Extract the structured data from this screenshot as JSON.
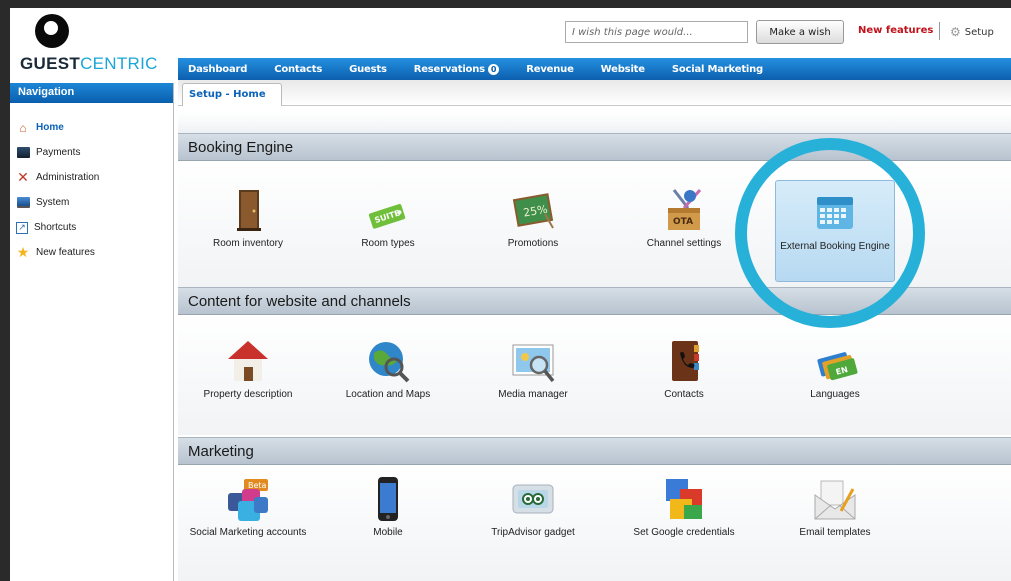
{
  "brand": {
    "part1": "GUEST",
    "part2": "CENTRIC"
  },
  "toolbar": {
    "wish_placeholder": "I wish this page would...",
    "wish_button": "Make a wish",
    "new_features": "New features",
    "setup": "Setup"
  },
  "nav": {
    "header": "Navigation",
    "items": [
      {
        "label": "Home",
        "icon": "home-icon"
      },
      {
        "label": "Payments",
        "icon": "payments-icon"
      },
      {
        "label": "Administration",
        "icon": "administration-icon"
      },
      {
        "label": "System",
        "icon": "system-icon"
      },
      {
        "label": "Shortcuts",
        "icon": "shortcuts-icon"
      },
      {
        "label": "New features",
        "icon": "star-icon"
      }
    ]
  },
  "topnav": {
    "items": [
      "Dashboard",
      "Contacts",
      "Guests",
      "Reservations",
      "Revenue",
      "Website",
      "Social Marketing"
    ],
    "reservations_badge": "0"
  },
  "tab": {
    "label": "Setup - Home"
  },
  "sections": [
    {
      "title": "Booking Engine",
      "items": [
        {
          "label": "Room inventory",
          "icon": "door-icon"
        },
        {
          "label": "Room types",
          "icon": "suite-tag-icon"
        },
        {
          "label": "Promotions",
          "icon": "chalkboard-icon"
        },
        {
          "label": "Channel settings",
          "icon": "ota-box-icon"
        },
        {
          "label": "External Booking Engine",
          "icon": "calendar-icon"
        }
      ]
    },
    {
      "title": "Content for website and channels",
      "items": [
        {
          "label": "Property description",
          "icon": "house-icon"
        },
        {
          "label": "Location and Maps",
          "icon": "globe-icon"
        },
        {
          "label": "Media manager",
          "icon": "picture-magnifier-icon"
        },
        {
          "label": "Contacts",
          "icon": "address-book-icon"
        },
        {
          "label": "Languages",
          "icon": "language-flags-icon"
        }
      ]
    },
    {
      "title": "Marketing",
      "items": [
        {
          "label": "Social Marketing accounts",
          "icon": "social-icon"
        },
        {
          "label": "Mobile",
          "icon": "phone-icon"
        },
        {
          "label": "TripAdvisor gadget",
          "icon": "tripadvisor-icon"
        },
        {
          "label": "Set Google credentials",
          "icon": "google-icon"
        },
        {
          "label": "Email templates",
          "icon": "envelope-icon"
        }
      ]
    }
  ],
  "icon_text": {
    "suite": "SUITE",
    "promo": "25%",
    "ota": "OTA",
    "lang": "EN",
    "beta": "Beta"
  },
  "colors": {
    "nav_blue": "#0c5fae",
    "accent": "#27b1d9",
    "alert_red": "#c0121a"
  }
}
